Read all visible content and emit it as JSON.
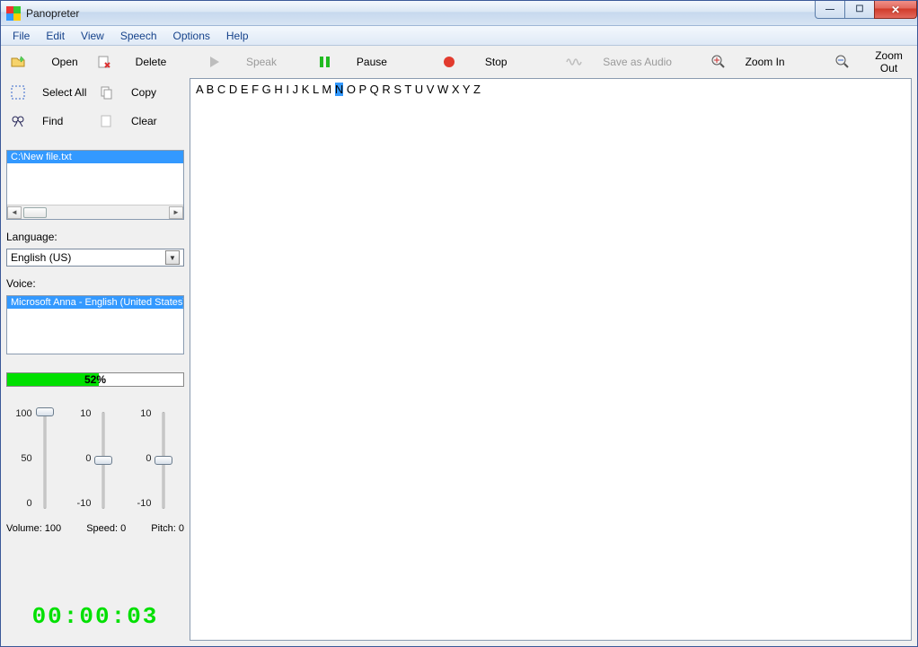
{
  "title": "Panopreter",
  "menu": [
    "File",
    "Edit",
    "View",
    "Speech",
    "Options",
    "Help"
  ],
  "toolbar": [
    {
      "id": "open",
      "label": "Open",
      "enabled": true,
      "icon": "open"
    },
    {
      "id": "delete",
      "label": "Delete",
      "enabled": true,
      "icon": "delete"
    },
    {
      "id": "speak",
      "label": "Speak",
      "enabled": false,
      "icon": "play"
    },
    {
      "id": "pause",
      "label": "Pause",
      "enabled": true,
      "icon": "pause"
    },
    {
      "id": "stop",
      "label": "Stop",
      "enabled": true,
      "icon": "stop"
    },
    {
      "id": "saveaudio",
      "label": "Save as Audio",
      "enabled": false,
      "icon": "wave"
    },
    {
      "id": "zoomin",
      "label": "Zoom In",
      "enabled": true,
      "icon": "zoomin"
    },
    {
      "id": "zoomout",
      "label": "Zoom Out",
      "enabled": true,
      "icon": "zoomout"
    }
  ],
  "side_actions": [
    {
      "id": "selectall",
      "label": "Select All",
      "icon": "selectall"
    },
    {
      "id": "copy",
      "label": "Copy",
      "icon": "copy"
    },
    {
      "id": "find",
      "label": "Find",
      "icon": "find"
    },
    {
      "id": "clear",
      "label": "Clear",
      "icon": "clear"
    }
  ],
  "files": [
    "C:\\New file.txt"
  ],
  "language_label": "Language:",
  "language_value": "English (US)",
  "voice_label": "Voice:",
  "voices": [
    "Microsoft Anna - English (United States)"
  ],
  "progress_percent": 52,
  "progress_text": "52%",
  "sliders": {
    "volume": {
      "max": "100",
      "mid": "50",
      "min": "0",
      "value": 100
    },
    "speed": {
      "max": "10",
      "mid": "0",
      "min": "-10",
      "value": 0
    },
    "pitch": {
      "max": "10",
      "mid": "0",
      "min": "-10",
      "value": 0
    }
  },
  "readout": {
    "volume": "Volume: 100",
    "speed": "Speed: 0",
    "pitch": "Pitch: 0"
  },
  "timer": "00:00:03",
  "editor": {
    "pre": "A B C D E F G H I J K L M ",
    "highlight": "N",
    "post": " O P Q R S T U V W X Y Z"
  }
}
